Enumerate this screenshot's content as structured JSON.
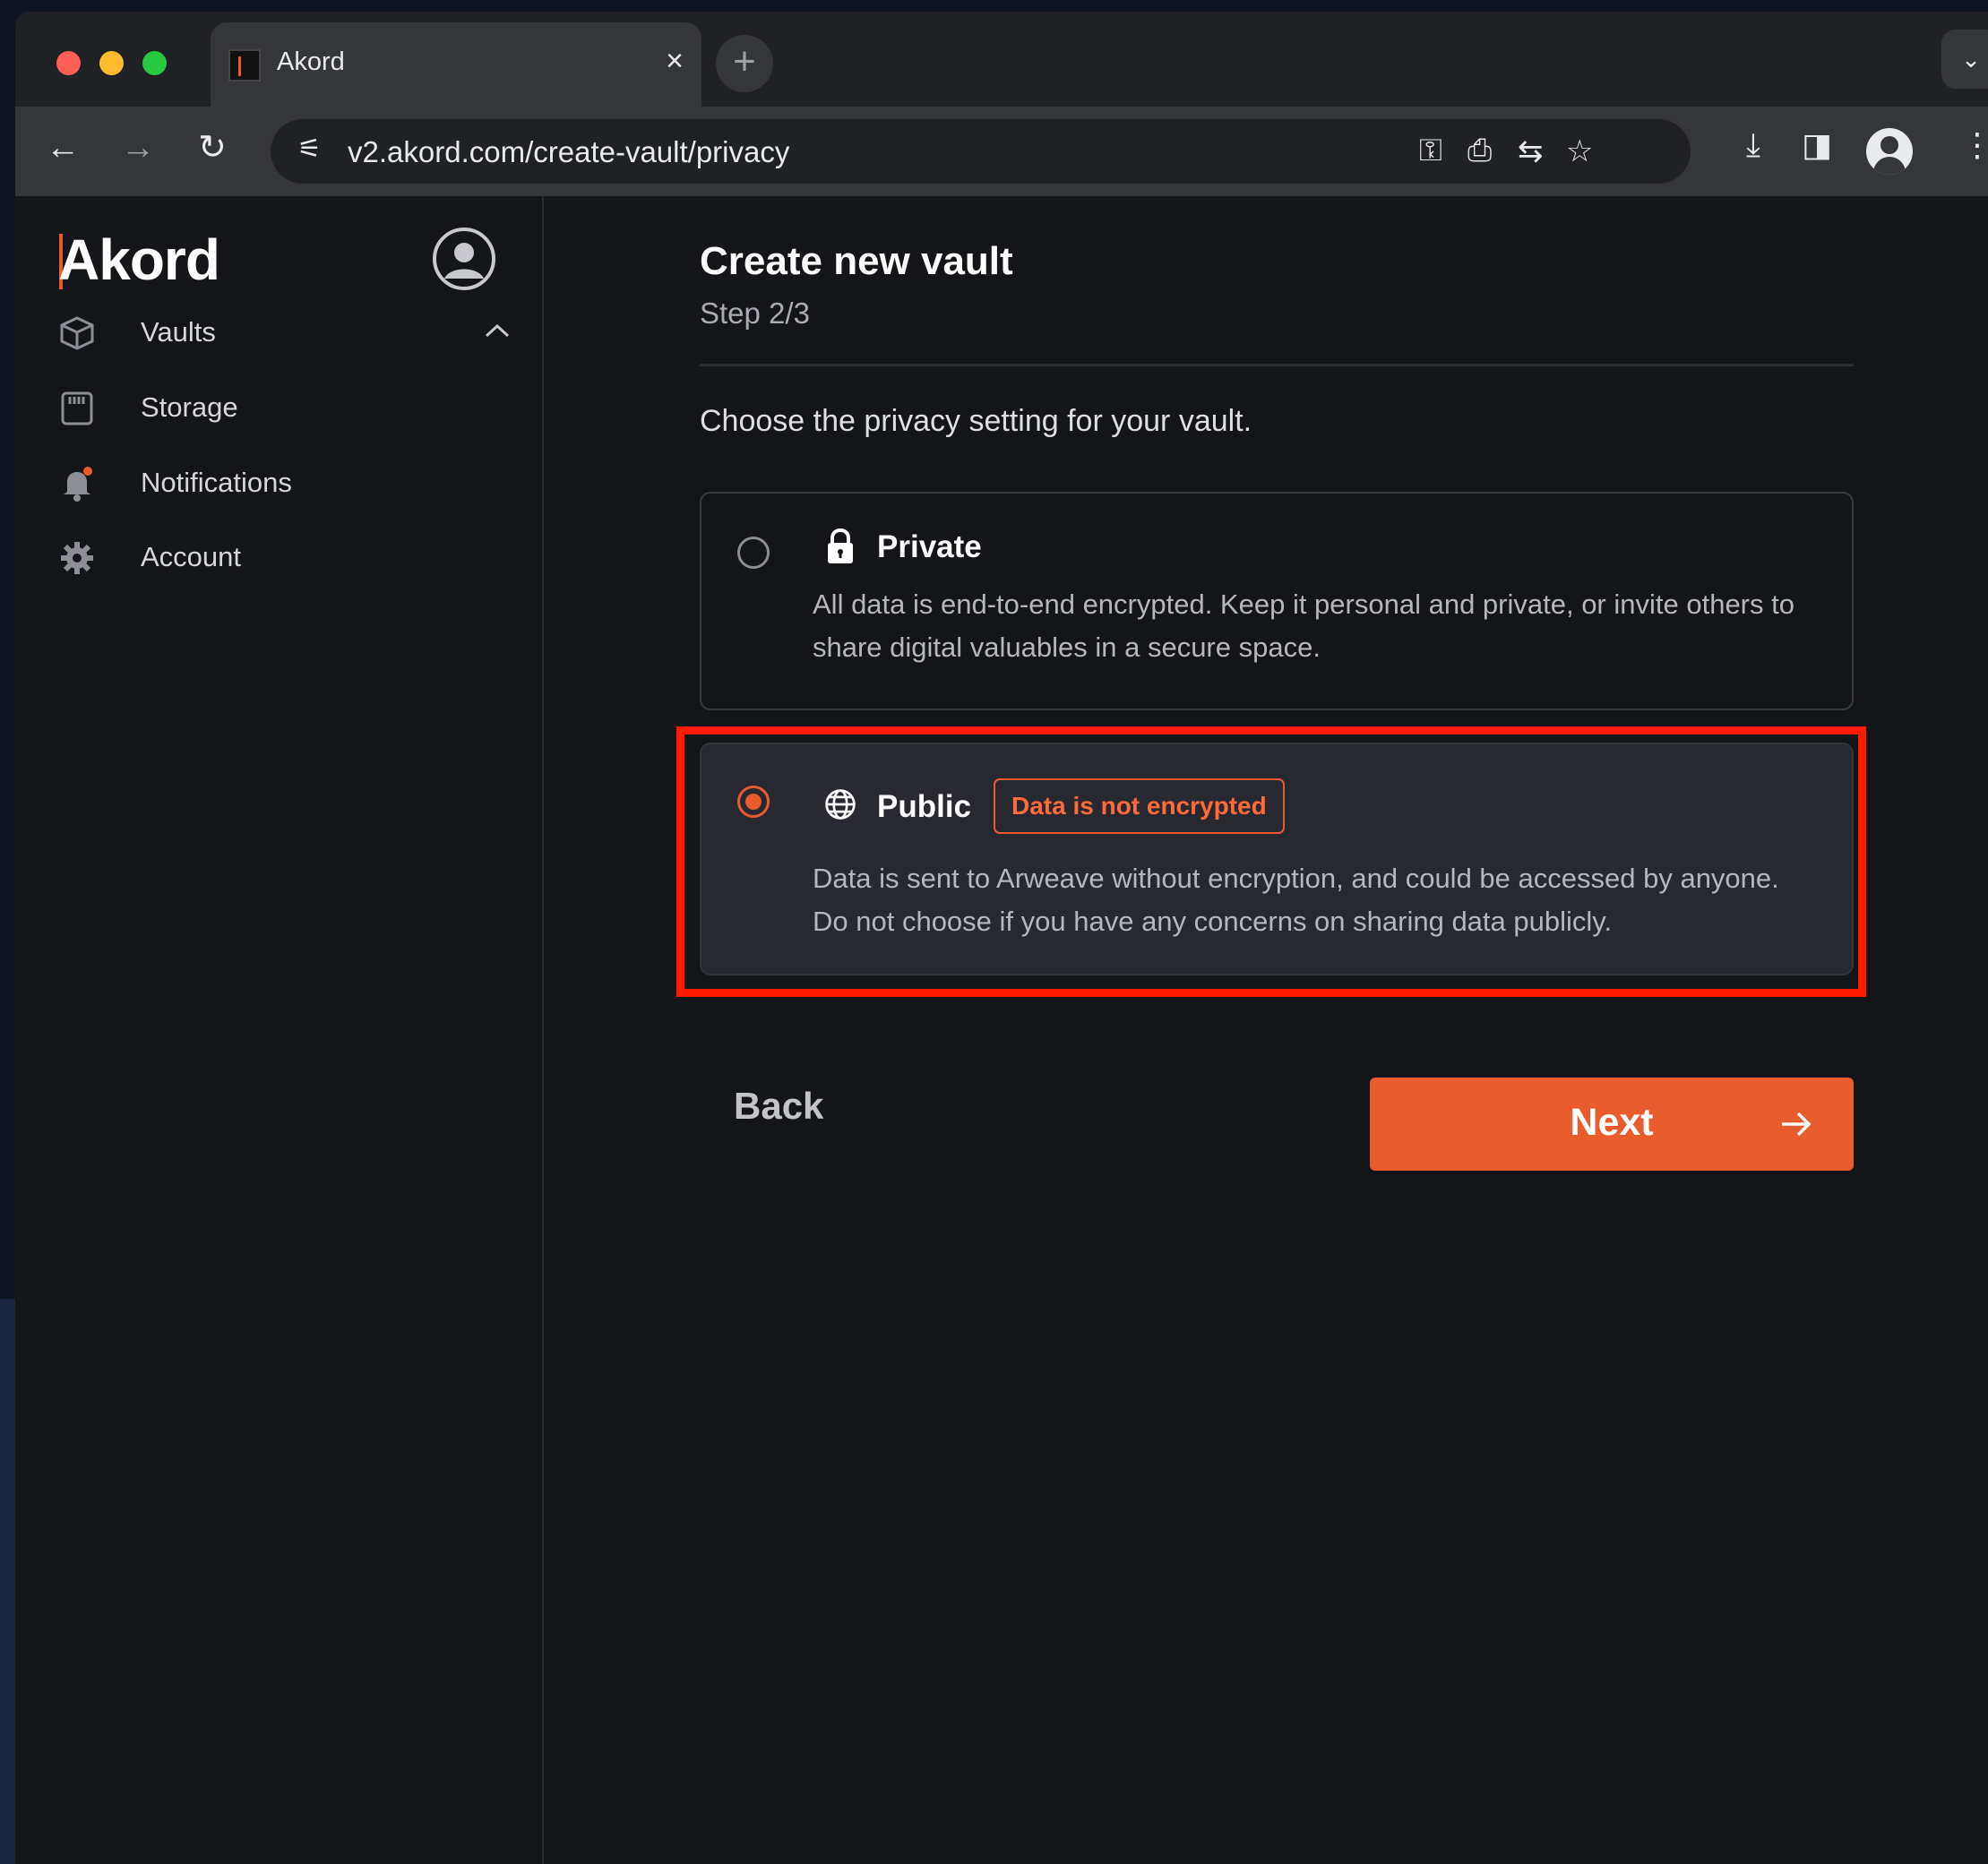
{
  "browser": {
    "tab_title": "Akord",
    "tab_close": "×",
    "new_tab": "+",
    "url": "v2.akord.com/create-vault/privacy",
    "nav": {
      "back": "←",
      "forward": "→",
      "reload": "↻"
    }
  },
  "sidebar": {
    "logo": "Akord",
    "items": [
      {
        "label": "Vaults",
        "icon": "cube-icon",
        "expanded": true
      },
      {
        "label": "Storage",
        "icon": "storage-card-icon"
      },
      {
        "label": "Notifications",
        "icon": "bell-icon"
      },
      {
        "label": "Account",
        "icon": "gear-icon"
      }
    ]
  },
  "main": {
    "title": "Create new vault",
    "step": "Step 2/3",
    "prompt": "Choose the privacy setting for your vault.",
    "options": [
      {
        "title": "Private",
        "icon": "lock-icon",
        "selected": false,
        "description": "All data is end-to-end encrypted. Keep it personal and private, or invite others to share digital valuables in a secure space."
      },
      {
        "title": "Public",
        "icon": "globe-icon",
        "selected": true,
        "badge": "Data is not encrypted",
        "description": "Data is sent to Arweave without encryption, and could be accessed by anyone. Do not choose if you have any concerns on sharing data publicly."
      }
    ],
    "back_label": "Back",
    "next_label": "Next"
  },
  "colors": {
    "accent": "#e85b2c",
    "highlight_box": "#ff1a00",
    "background": "#141519",
    "selected_card": "#272830"
  }
}
